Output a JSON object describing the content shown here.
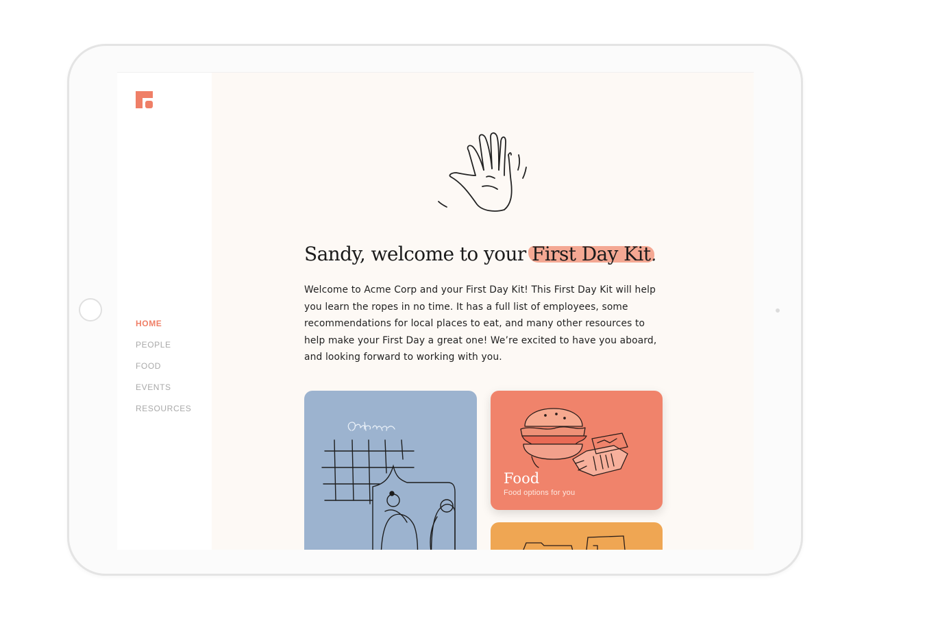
{
  "app": {
    "logo_icon": "first-day-kit-logo-icon",
    "accent_color": "#ef7f67"
  },
  "nav": {
    "items": [
      {
        "label": "HOME",
        "active": true
      },
      {
        "label": "PEOPLE",
        "active": false
      },
      {
        "label": "FOOD",
        "active": false
      },
      {
        "label": "EVENTS",
        "active": false
      },
      {
        "label": "RESOURCES",
        "active": false
      }
    ]
  },
  "welcome": {
    "illustration_icon": "waving-hand-icon",
    "headline_prefix": "Sandy, welcome to your ",
    "headline_highlight": "First Day Kit",
    "headline_suffix": ".",
    "intro": "Welcome to Acme Corp and your First Day Kit! This First Day Kit will help you learn the ropes in no time. It has a full list of employees, some recommendations for local places to eat, and many other resources to help make your First Day a great one! We’re excited to have you aboard, and looking forward to working with you."
  },
  "cards": {
    "events": {
      "illustration_text": "October",
      "color": "#9cb3cf"
    },
    "food": {
      "title": "Food",
      "subtitle": "Food options for you",
      "color": "#f0836b"
    },
    "resources": {
      "color": "#efa653"
    }
  }
}
